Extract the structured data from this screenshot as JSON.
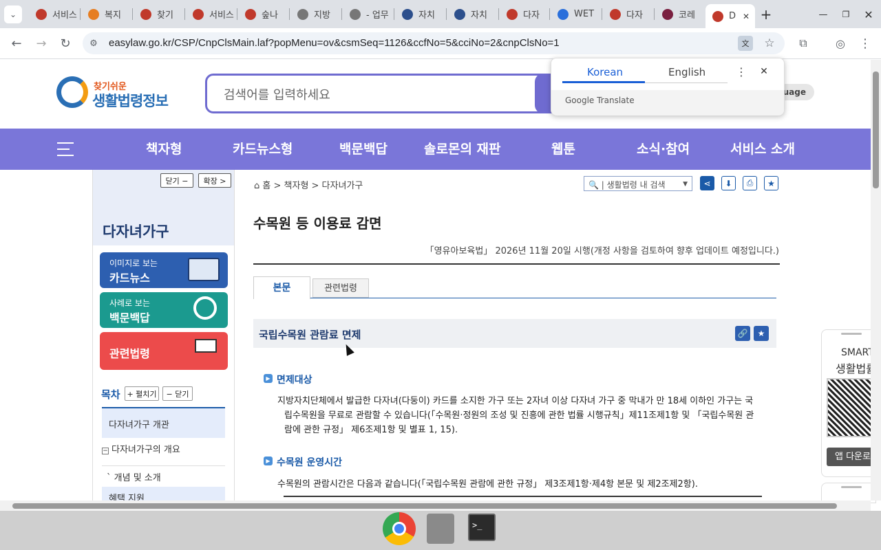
{
  "browser": {
    "tabs": [
      {
        "label": "서비스",
        "fav": "#c0392b"
      },
      {
        "label": "복지",
        "fav": "#e67e22"
      },
      {
        "label": "찾기",
        "fav": "#c0392b"
      },
      {
        "label": "서비스",
        "fav": "#c0392b"
      },
      {
        "label": "숲나",
        "fav": "#c0392b"
      },
      {
        "label": "지방",
        "fav": "#777"
      },
      {
        "label": "- 업무",
        "fav": "#777"
      },
      {
        "label": "자치",
        "fav": "#2c4f8c"
      },
      {
        "label": "자치",
        "fav": "#2c4f8c"
      },
      {
        "label": "다자",
        "fav": "#c0392b"
      },
      {
        "label": "WET",
        "fav": "#2a6fdb"
      },
      {
        "label": "다자",
        "fav": "#c0392b"
      },
      {
        "label": "코레",
        "fav": "#7a2040"
      },
      {
        "label": "D",
        "fav": "#c0392b"
      }
    ],
    "url": "easylaw.go.kr/CSP/CnpClsMain.laf?popMenu=ov&csmSeq=1126&ccfNo=5&cciNo=2&cnpClsNo=1",
    "new_tab": "+"
  },
  "translate_popup": {
    "tab_korean": "Korean",
    "tab_english": "English",
    "footer": "Google Translate"
  },
  "site": {
    "logo_top": "찾기쉬운",
    "logo_bottom": "생활법령정보",
    "search_placeholder": "검색어를 입력하세요",
    "language_btn": "guage",
    "nav": [
      "책자형",
      "카드뉴스형",
      "백문백답",
      "솔로몬의 재판",
      "웹툰",
      "소식·참여",
      "서비스 소개"
    ]
  },
  "sidebar": {
    "close_btn": "닫기 −",
    "expand_btn": "확장 >",
    "title": "다자녀가구",
    "cards": [
      {
        "small": "이미지로 보는",
        "big": "카드뉴스",
        "color": "#2d5fb0"
      },
      {
        "small": "사례로 보는",
        "big": "백문백답",
        "color": "#1b9a8f"
      },
      {
        "small": "",
        "big": "관련법령",
        "color": "#ec4b4b"
      }
    ],
    "toc_label": "목차",
    "toc_expand": "+ 펼치기",
    "toc_collapse": "− 닫기",
    "toc_items": [
      "다자녀가구 개관",
      "다자녀가구의 개요",
      "개념 및 소개",
      "혜택 지원"
    ]
  },
  "content": {
    "breadcrumb": "홈 > 책자형 > 다자녀가구",
    "inner_search": "생활법령 내 검색",
    "title": "수목원 등 이용료 감면",
    "enforcement": "「영유아보육법」 2026년 11월 20일 시행(개정 사항을 검토하여 향후 업데이트 예정입니다.)",
    "tabs": [
      "본문",
      "관련법령"
    ],
    "section_title": "국립수목원 관람료 면제",
    "h1": "면제대상",
    "p1a": "지방자치단체에서 발급한 다자녀(다둥이) 카드를 소지한 가구 또는 2자녀 이상 다자녀 가구 중 막내가 만 18세 이하인 가구는 국",
    "p1b": "립수목원을 무료로 관람할 수 있습니다(「수목원·정원의 조성 및 진흥에 관한 법률 시행규칙」제11조제1항 및 「국립수목원 관",
    "p1c": "람에 관한 규정」 제6조제1항 및 별표 1, 15).",
    "h2": "수목원 운영시간",
    "p2": "수목원의 관람시간은 다음과 같습니다(「국립수목원 관람에 관한 규정」 제3조제1항·제4항 본문 및 제2조제2항)."
  },
  "smart": {
    "title1": "SMART",
    "title2": "생활법률",
    "app_btn": "앱 다운로"
  },
  "colors": {
    "nav": "#7a76d9",
    "accent": "#1a5aa8",
    "tab_active": "#1a5aa8"
  }
}
